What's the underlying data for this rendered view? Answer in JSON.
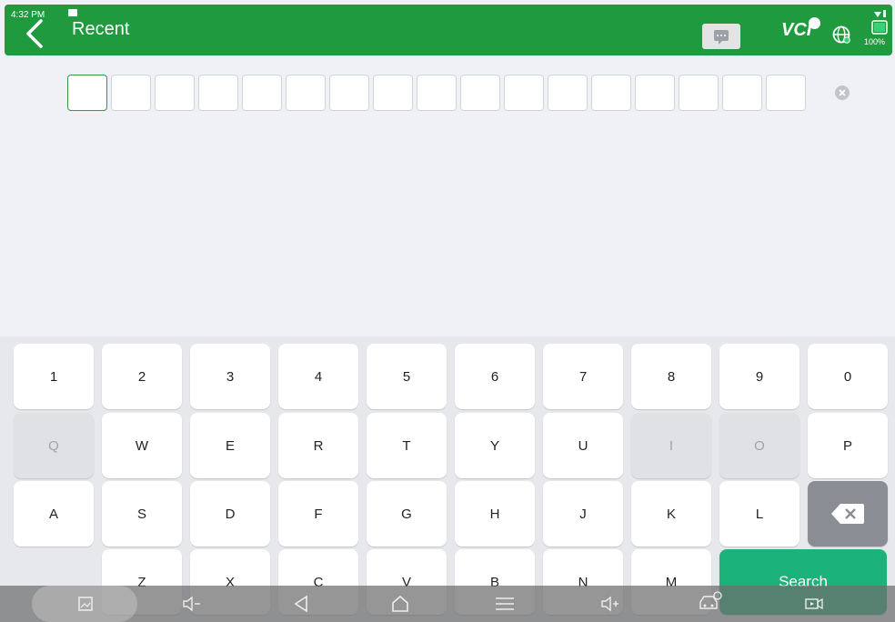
{
  "status": {
    "time": "4:32 PM",
    "battery": "100%"
  },
  "header": {
    "title": "Recent",
    "vci": "VCI"
  },
  "keyboard": {
    "row1": [
      "1",
      "2",
      "3",
      "4",
      "5",
      "6",
      "7",
      "8",
      "9",
      "0"
    ],
    "row2": [
      "Q",
      "W",
      "E",
      "R",
      "T",
      "Y",
      "U",
      "I",
      "O",
      "P"
    ],
    "row3": [
      "A",
      "S",
      "D",
      "F",
      "G",
      "H",
      "J",
      "K",
      "L"
    ],
    "row4": [
      "Z",
      "X",
      "C",
      "V",
      "B",
      "N",
      "M"
    ],
    "search_label": "Search"
  }
}
